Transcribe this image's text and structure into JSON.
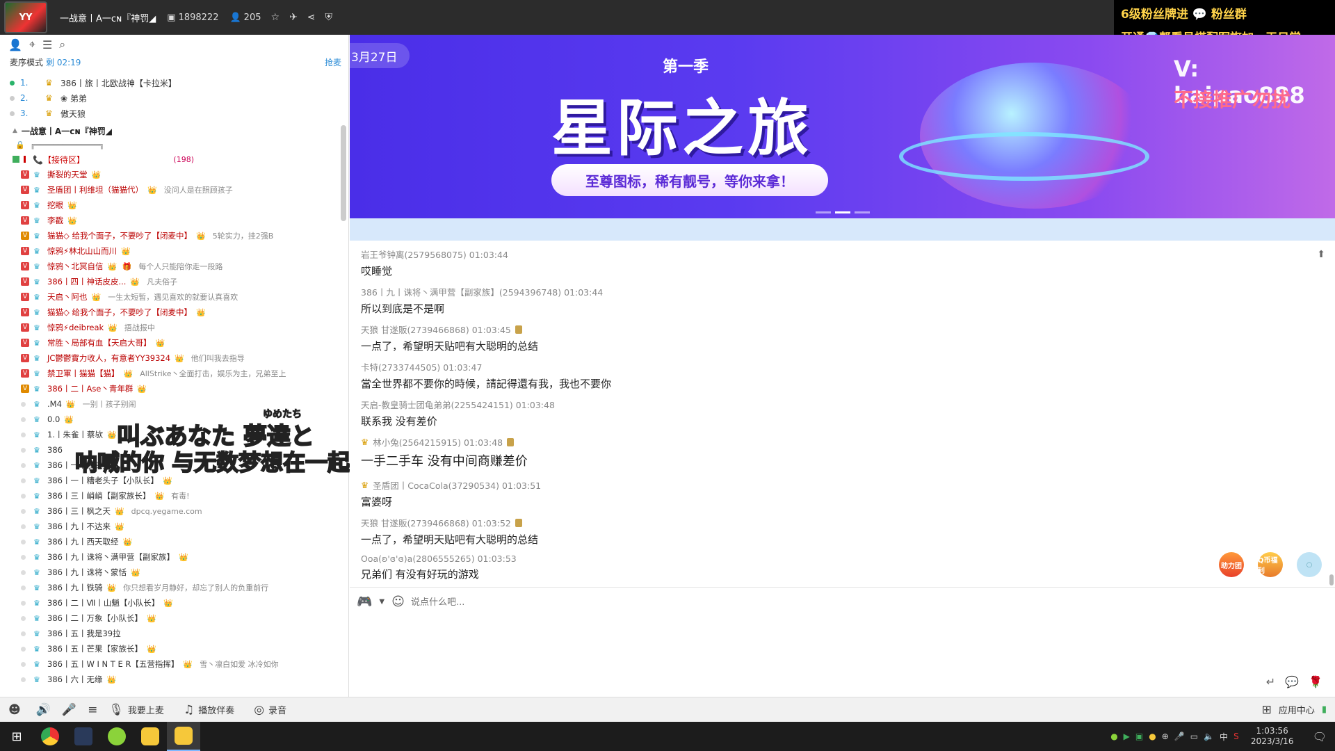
{
  "titlebar": {
    "room_title": "一战意丨A一ᴄɴ『神罚◢",
    "room_id": "1898222",
    "online": "205"
  },
  "promo": {
    "line1": "6级粉丝牌进 💬 粉丝群",
    "line2": "开通💎帮看号搭配军旗加一天日常"
  },
  "left": {
    "queue_mode_label": "麦序模式",
    "queue_timer": "剩 02:19",
    "grab_label": "抢麦",
    "queue": [
      {
        "num": "1.",
        "name": "386丨旅丨北欧战神【卡拉米】",
        "dot": "#2ab36a"
      },
      {
        "num": "2.",
        "name": "❀ 弟弟",
        "dot": "#cccccc"
      },
      {
        "num": "3.",
        "name": "傲天狼",
        "dot": "#cccccc"
      }
    ],
    "channel_name": "一战意丨A一ᴄɴ『神罚◢",
    "sub_channel": "╔══════════════╗",
    "zone_name": "📞【接待区】",
    "zone_count": "(198)",
    "users": [
      {
        "badge": "#e04040",
        "name": "撕裂的天堂",
        "medals": "👑",
        "sign": "",
        "red": true
      },
      {
        "badge": "#e04040",
        "name": "圣盾团丨利维坦（猫猫代）",
        "medals": "👑",
        "sign": "没问人是在照顾孩子",
        "red": true
      },
      {
        "badge": "#e04040",
        "name": "挖眼",
        "medals": "👑",
        "sign": "",
        "red": true
      },
      {
        "badge": "#e04040",
        "name": "李戳",
        "medals": "👑",
        "sign": "",
        "red": true
      },
      {
        "badge": "#e08a00",
        "name": "猫猫◇ 给我个面子，不要吵了【闭麦中】",
        "medals": "👑",
        "sign": "5轮实力，挂2强B",
        "red": true
      },
      {
        "badge": "#e04040",
        "name": "惊鸦⚡林北山山而川",
        "medals": "👑",
        "sign": "",
        "red": true
      },
      {
        "badge": "#e04040",
        "name": "惊鸦丶北冥自信",
        "medals": "👑 🎁",
        "sign": "每个人只能陪你走一段路",
        "red": true
      },
      {
        "badge": "#e04040",
        "name": "386丨四丨神话皮皮...",
        "medals": "👑",
        "sign": "凡夫俗子",
        "red": true
      },
      {
        "badge": "#e04040",
        "name": "天启丶阿也",
        "medals": "👑",
        "sign": "一生太短暂，遇见喜欢的就要认真喜欢",
        "red": true
      },
      {
        "badge": "#e04040",
        "name": "猫猫◇ 给我个面子，不要吵了【闭麦中】",
        "medals": "👑",
        "sign": "",
        "red": true
      },
      {
        "badge": "#e04040",
        "name": "惊鸦⚡deibreak",
        "medals": "👑",
        "sign": "捂战报中",
        "red": true
      },
      {
        "badge": "#e04040",
        "name": "常胜丶局部有血【天启大哥】",
        "medals": "👑",
        "sign": "",
        "red": true
      },
      {
        "badge": "#e04040",
        "name": "JC鬱鬱實力收人，有意者YY39324",
        "medals": "👑",
        "sign": "他们叫我去指导",
        "red": true
      },
      {
        "badge": "#e04040",
        "name": "禁卫軍丨猫猫【猫】",
        "medals": "👑",
        "sign": "AllStrike丶全面打击，娱乐为主，兄弟至上",
        "red": true
      },
      {
        "badge": "#e08a00",
        "name": "386丨二丨Ase丶青年群",
        "medals": "👑",
        "sign": "",
        "red": true
      },
      {
        "badge": "",
        "name": ".M4",
        "medals": "👑",
        "sign": "一别丨孩子别闹",
        "red": false
      },
      {
        "badge": "",
        "name": "0.0",
        "medals": "👑",
        "sign": "",
        "red": false
      },
      {
        "badge": "",
        "name": "1.丨朱雀丨蔡欤",
        "medals": "👑",
        "sign": "",
        "red": false
      },
      {
        "badge": "",
        "name": "386",
        "medals": "",
        "sign": "",
        "red": false
      },
      {
        "badge": "",
        "name": "386丨一丨浙铁鳖",
        "medals": "",
        "sign": "",
        "red": false
      },
      {
        "badge": "",
        "name": "386丨一丨糟老头子【小队长】",
        "medals": "👑",
        "sign": "",
        "red": false
      },
      {
        "badge": "",
        "name": "386丨三丨峭峭【副家族长】",
        "medals": "👑",
        "sign": "有毒!",
        "red": false
      },
      {
        "badge": "",
        "name": "386丨三丨枫之天",
        "medals": "👑",
        "sign": "dpcq.yegame.com",
        "red": false
      },
      {
        "badge": "",
        "name": "386丨九丨不达来",
        "medals": "👑",
        "sign": "",
        "red": false
      },
      {
        "badge": "",
        "name": "386丨九丨西天取经",
        "medals": "👑",
        "sign": "",
        "red": false
      },
      {
        "badge": "",
        "name": "386丨九丨诛将丶满甲营【副家族】",
        "medals": "👑",
        "sign": "",
        "red": false
      },
      {
        "badge": "",
        "name": "386丨九丨诛将丶蒙恬",
        "medals": "👑",
        "sign": "",
        "red": false
      },
      {
        "badge": "",
        "name": "386丨九丨铁骑",
        "medals": "👑",
        "sign": "你只想看岁月静好，却忘了别人的负重前行",
        "red": false
      },
      {
        "badge": "",
        "name": "386丨二丨Ⅶ丨山魈【小队长】",
        "medals": "👑",
        "sign": "",
        "red": false
      },
      {
        "badge": "",
        "name": "386丨二丨万象【小队长】",
        "medals": "👑",
        "sign": "",
        "red": false
      },
      {
        "badge": "",
        "name": "386丨五丨我是39拉",
        "medals": "",
        "sign": "",
        "red": false
      },
      {
        "badge": "",
        "name": "386丨五丨芒果【家族长】",
        "medals": "👑",
        "sign": "",
        "red": false
      },
      {
        "badge": "",
        "name": "386丨五丨W I N T E R【五营指挥】",
        "medals": "👑",
        "sign": "雪丶凛白如爱 冰冷如你",
        "red": false
      },
      {
        "badge": "",
        "name": "386丨六丨无缘",
        "medals": "👑",
        "sign": "",
        "red": false
      }
    ]
  },
  "lyrics": {
    "line1": "叫ぶあなた  夢達と",
    "ruby": "ゆめたち",
    "line2": "呐喊的你  与无数梦想在一起"
  },
  "banner": {
    "date": "3月27日",
    "season": "第一季",
    "title": "星际之旅",
    "pill": "至尊图标，稀有靓号，等你来拿！",
    "watermark1": "V:  baipao888",
    "watermark2": "不接推广勿扰"
  },
  "chat": {
    "messages": [
      {
        "head": "岩王爷钟离(2579568075)  01:03:44",
        "body": "哎睡觉",
        "big": false,
        "crown": false,
        "badge": false
      },
      {
        "head": "386丨九丨诛将丶满甲营【副家族】(2594396748)  01:03:44",
        "body": "所以到底是不是啊",
        "big": false,
        "crown": false,
        "badge": false
      },
      {
        "head": "天狼 甘遂販(2739466868)  01:03:45",
        "body": "一点了，希望明天贴吧有大聪明的总结",
        "big": false,
        "crown": false,
        "badge": true
      },
      {
        "head": "卡特(2733744505)  01:03:47",
        "body": "當全世界都不要你的時候，請記得還有我，我也不要你",
        "big": false,
        "crown": false,
        "badge": false
      },
      {
        "head": "天启-教皇骑士团龟弟弟(2255424151)  01:03:48",
        "body": "联系我 没有差价",
        "big": false,
        "crown": false,
        "badge": false
      },
      {
        "head": "林小兔(2564215915)  01:03:48",
        "body": "一手二手车 没有中间商赚差价",
        "big": true,
        "crown": true,
        "badge": true
      },
      {
        "head": "圣盾团丨CocaCola(37290534)  01:03:51",
        "body": "富婆呀",
        "big": false,
        "crown": true,
        "badge": false
      },
      {
        "head": "天狼 甘遂販(2739466868)  01:03:52",
        "body": "一点了，希望明天贴吧有大聪明的总结",
        "big": false,
        "crown": false,
        "badge": true
      },
      {
        "head": "Ooa(ʚ'ɞ'ɞ)a(2806555265)  01:03:53",
        "body": "兄弟们 有没有好玩的游戏",
        "big": false,
        "crown": false,
        "badge": false
      }
    ],
    "fab1": "助力团",
    "fab2": "Q币福利"
  },
  "input": {
    "placeholder": "说点什么吧..."
  },
  "bottombar": {
    "mic_label": "我要上麦",
    "music_label": "播放伴奏",
    "record_label": "录音",
    "app_center": "应用中心"
  },
  "taskbar": {
    "time": "1:03:56",
    "date": "2023/3/16",
    "ime": "中"
  }
}
